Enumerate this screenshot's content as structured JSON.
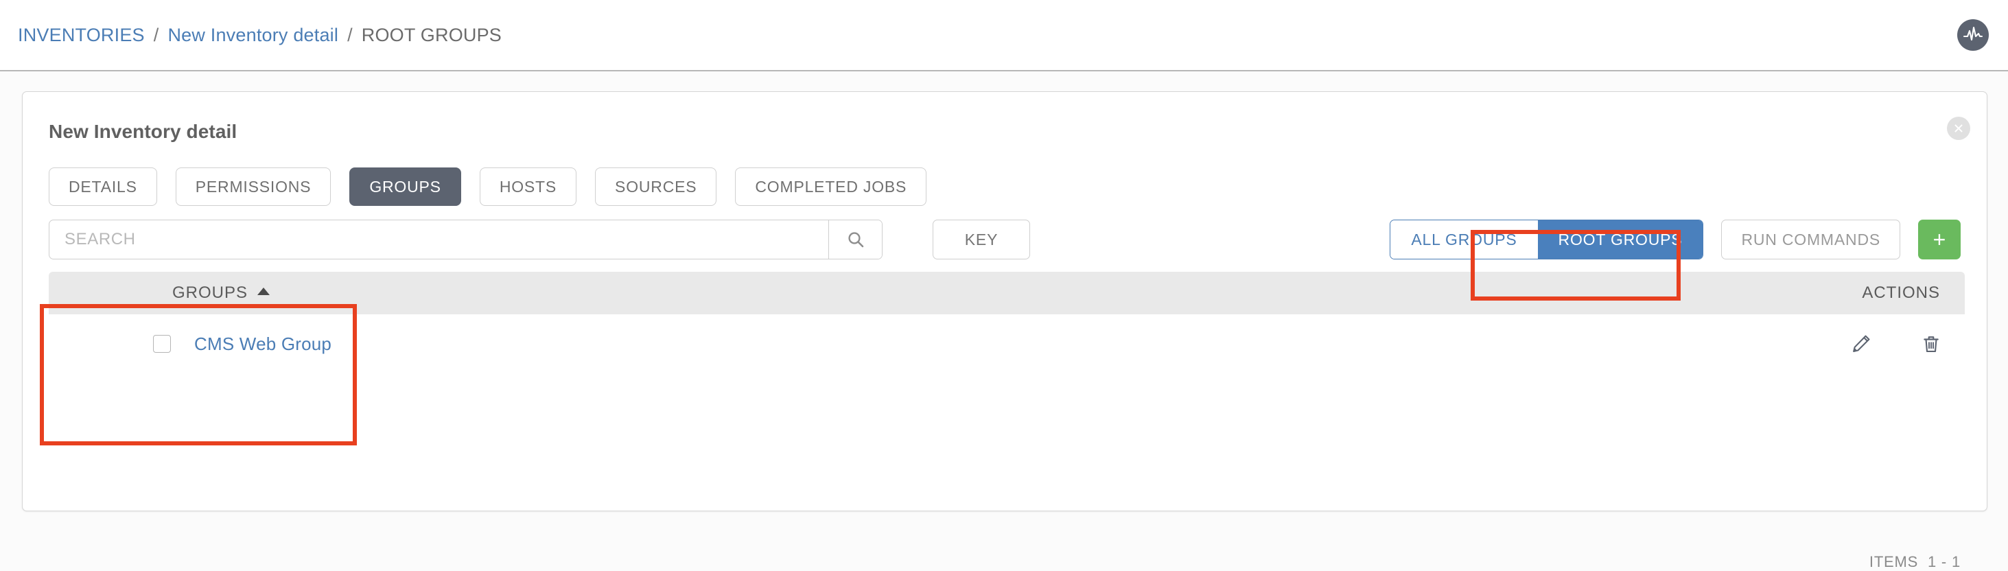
{
  "breadcrumb": {
    "items": [
      {
        "label": "INVENTORIES",
        "type": "link"
      },
      {
        "label": "New Inventory detail",
        "type": "link"
      },
      {
        "label": "ROOT GROUPS",
        "type": "current"
      }
    ],
    "separator": "/"
  },
  "brand": {
    "icon": "pulse-logo-icon"
  },
  "card": {
    "title": "New Inventory detail",
    "close_label": "close-icon"
  },
  "tabs": [
    {
      "label": "DETAILS",
      "active": false
    },
    {
      "label": "PERMISSIONS",
      "active": false
    },
    {
      "label": "GROUPS",
      "active": true
    },
    {
      "label": "HOSTS",
      "active": false
    },
    {
      "label": "SOURCES",
      "active": false
    },
    {
      "label": "COMPLETED JOBS",
      "active": false
    }
  ],
  "toolbar": {
    "search_placeholder": "SEARCH",
    "search_value": "",
    "search_icon": "magnifier-icon",
    "key_label": "KEY",
    "all_groups_label": "ALL GROUPS",
    "root_groups_label": "ROOT GROUPS",
    "root_groups_active": true,
    "run_commands_label": "RUN COMMANDS",
    "add_label": "+"
  },
  "table": {
    "columns": {
      "groups": "GROUPS",
      "actions": "ACTIONS"
    },
    "sort": {
      "column": "GROUPS",
      "direction": "asc"
    },
    "rows": [
      {
        "name": "CMS Web Group",
        "checked": false,
        "actions": [
          "edit-pencil-icon",
          "delete-trash-icon"
        ]
      }
    ]
  },
  "footer": {
    "items_label": "ITEMS",
    "items_range": "1 - 1"
  },
  "colors": {
    "link_blue": "#4b7db5",
    "active_tab_gray": "#5c6370",
    "toggle_active_blue": "#4a80bd",
    "add_green": "#6aba5e",
    "annotation_red": "#e8401f",
    "table_header_gray": "#e9e9e9"
  },
  "annotations": [
    {
      "name": "root-groups-highlight",
      "target": "ROOT GROUPS"
    },
    {
      "name": "groups-list-highlight",
      "target": "GROUPS column + CMS Web Group"
    }
  ]
}
